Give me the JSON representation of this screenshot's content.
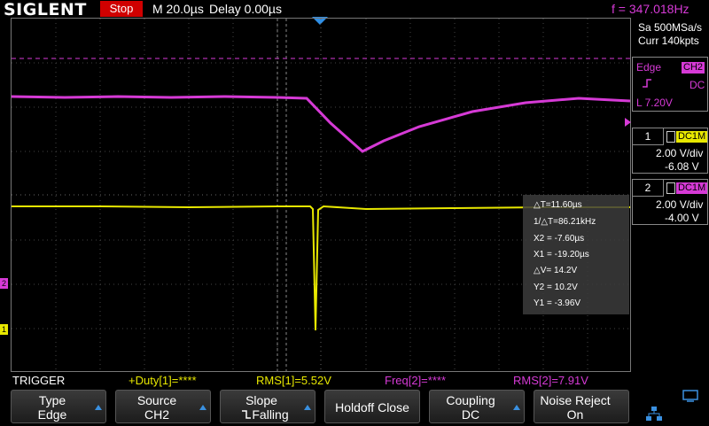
{
  "header": {
    "brand": "SIGLENT",
    "run_state": "Stop",
    "timebase": "M 20.0µs",
    "delay": "Delay 0.00µs",
    "frequency": "f = 347.018Hz"
  },
  "acquisition": {
    "sample_rate": "Sa 500MSa/s",
    "memory": "Curr 140kpts"
  },
  "trigger_panel": {
    "type": "Edge",
    "source": "CH2",
    "slope_icon": "rising-edge-icon",
    "coupling": "DC",
    "level": "L  7.20V"
  },
  "channels": [
    {
      "number": "1",
      "coupling": "DC1M",
      "scale": "2.00 V/div",
      "offset": "-6.08 V",
      "color": "#e8e800",
      "icon": "bandwidth-icon"
    },
    {
      "number": "2",
      "coupling": "DC1M",
      "scale": "2.00 V/div",
      "offset": "-4.00 V",
      "color": "#d63ad6",
      "icon": "bandwidth-icon"
    }
  ],
  "cursor_readout": {
    "delta_t": "△T=11.60µs",
    "inv_delta_t": "1/△T=86.21kHz",
    "x2": "X2 = -7.60µs",
    "x1": "X1 = -19.20µs",
    "delta_v": "△V= 14.2V",
    "y2": "Y2 = 10.2V",
    "y1": "Y1 = -3.96V"
  },
  "measurements": {
    "label": "TRIGGER",
    "duty1": "+Duty[1]=****",
    "rms1": "RMS[1]=5.52V",
    "freq2": "Freq[2]=****",
    "rms2": "RMS[2]=7.91V"
  },
  "softkeys": [
    {
      "line1": "Type",
      "line2": "Edge"
    },
    {
      "line1": "Source",
      "line2": "CH2"
    },
    {
      "line1": "Slope",
      "line2": "Falling"
    },
    {
      "line1": "Holdoff Close"
    },
    {
      "line1": "Coupling",
      "line2": "DC"
    },
    {
      "line1": "Noise Reject",
      "line2": "On"
    }
  ],
  "markers": {
    "ch1_marker": "1",
    "ch2_marker": "2"
  },
  "colors": {
    "ch1": "#e8e800",
    "ch2": "#d63ad6",
    "accent": "#2f8fe6",
    "stop": "#d00000"
  }
}
